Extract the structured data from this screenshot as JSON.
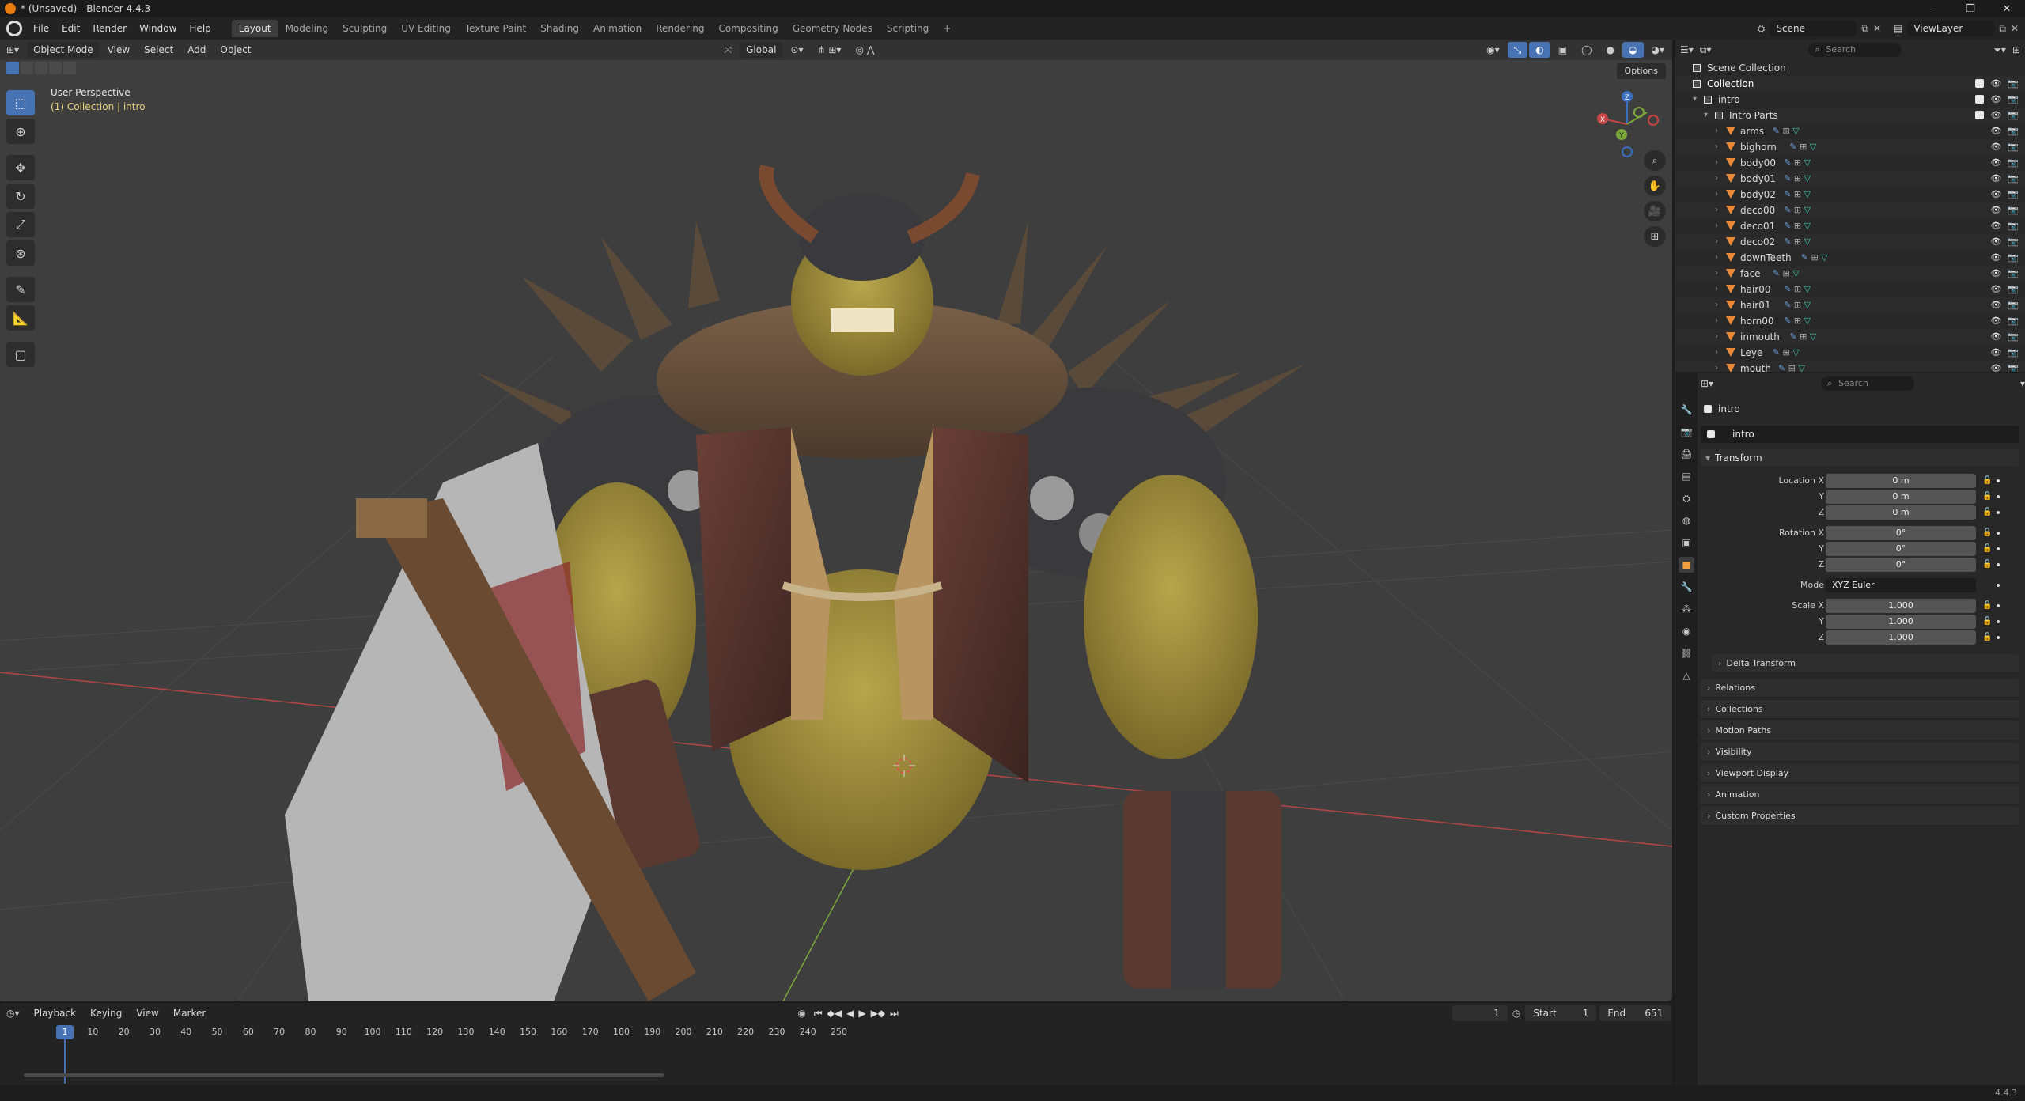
{
  "window": {
    "title": "* (Unsaved) - Blender 4.4.3",
    "controls": [
      "–",
      "❐",
      "✕"
    ]
  },
  "menu": [
    "File",
    "Edit",
    "Render",
    "Window",
    "Help"
  ],
  "workspaces": [
    "Layout",
    "Modeling",
    "Sculpting",
    "UV Editing",
    "Texture Paint",
    "Shading",
    "Animation",
    "Rendering",
    "Compositing",
    "Geometry Nodes",
    "Scripting",
    "+"
  ],
  "active_workspace": "Layout",
  "scene": {
    "name": "Scene",
    "view_layer": "ViewLayer"
  },
  "viewport": {
    "mode": "Object Mode",
    "menus": [
      "View",
      "Select",
      "Add",
      "Object"
    ],
    "orientation": "Global",
    "options_label": "Options",
    "perspective_label": "User Perspective",
    "collection_label": "(1) Collection | intro",
    "gizmo_axes": [
      "Z",
      "Y",
      "X"
    ]
  },
  "toolbar_icons": [
    "select-box-icon",
    "cursor-icon",
    "move-icon",
    "rotate-icon",
    "scale-icon",
    "transform-icon",
    "annotate-icon",
    "measure-icon",
    "add-cube-icon"
  ],
  "timeline": {
    "menus": [
      "Playback",
      "Keying",
      "View",
      "Marker"
    ],
    "current_frame": "1",
    "start_label": "Start",
    "start": "1",
    "end_label": "End",
    "end": "651",
    "ticks": [
      "1",
      "10",
      "20",
      "30",
      "40",
      "50",
      "60",
      "70",
      "80",
      "90",
      "100",
      "110",
      "120",
      "130",
      "140",
      "150",
      "160",
      "170",
      "180",
      "190",
      "200",
      "210",
      "220",
      "230",
      "240",
      "250"
    ]
  },
  "outliner": {
    "search_placeholder": "Search",
    "scene_collection": "Scene Collection",
    "collection": "Collection",
    "intro": "intro",
    "intro_parts": "Intro Parts",
    "objects": [
      "arms",
      "bighorn",
      "body00",
      "body01",
      "body02",
      "deco00",
      "deco01",
      "deco02",
      "downTeeth",
      "face",
      "hair00",
      "hair01",
      "horn00",
      "inmouth",
      "Leye",
      "mouth"
    ]
  },
  "properties": {
    "search_placeholder": "Search",
    "object_name": "intro",
    "name_field": "intro",
    "transform_label": "Transform",
    "location": {
      "label": "Location X",
      "x": "0 m",
      "y": "0 m",
      "z": "0 m"
    },
    "rotation": {
      "label": "Rotation X",
      "x": "0°",
      "y": "0°",
      "z": "0°"
    },
    "mode": {
      "label": "Mode",
      "value": "XYZ Euler"
    },
    "scale": {
      "label": "Scale X",
      "x": "1.000",
      "y": "1.000",
      "z": "1.000"
    },
    "axis_y": "Y",
    "axis_z": "Z",
    "delta_transform": "Delta Transform",
    "panels": [
      "Relations",
      "Collections",
      "Motion Paths",
      "Visibility",
      "Viewport Display",
      "Animation",
      "Custom Properties"
    ]
  },
  "status": {
    "version": "4.4.3"
  },
  "colors": {
    "accent": "#4772b3",
    "object_orange": "#e88a36",
    "collection_label": "#e8d27a",
    "viewport_bg": "#3e3e3e"
  }
}
